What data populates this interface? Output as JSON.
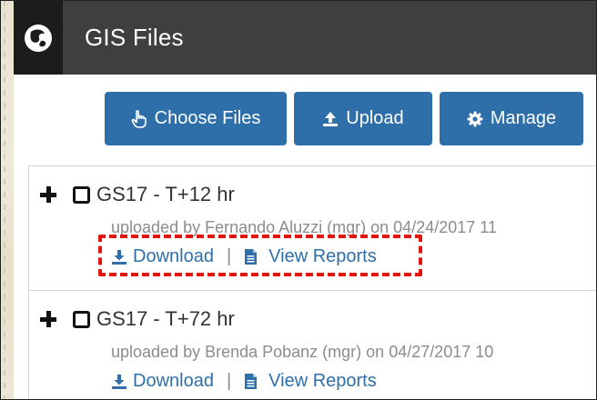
{
  "header": {
    "title": "GIS Files",
    "logo_icon": "globe-logo-icon"
  },
  "toolbar": {
    "choose_label": "Choose Files",
    "upload_label": "Upload",
    "manage_label": "Manage",
    "button_color": "#2e6faa"
  },
  "files": [
    {
      "name": "GS17 - T+12 hr",
      "meta": "uploaded by Fernando Aluzzi (mgr) on 04/24/2017 11",
      "download_label": "Download",
      "separator": "|",
      "reports_label": "View Reports",
      "highlighted": true
    },
    {
      "name": "GS17 - T+72 hr",
      "meta": "uploaded by Brenda Pobanz (mgr) on 04/27/2017 10",
      "download_label": "Download",
      "separator": "|",
      "reports_label": "View Reports",
      "highlighted": false
    }
  ],
  "colors": {
    "header_bg": "#3f3f3f",
    "link": "#2e6faa",
    "highlight": "#e3160f"
  }
}
